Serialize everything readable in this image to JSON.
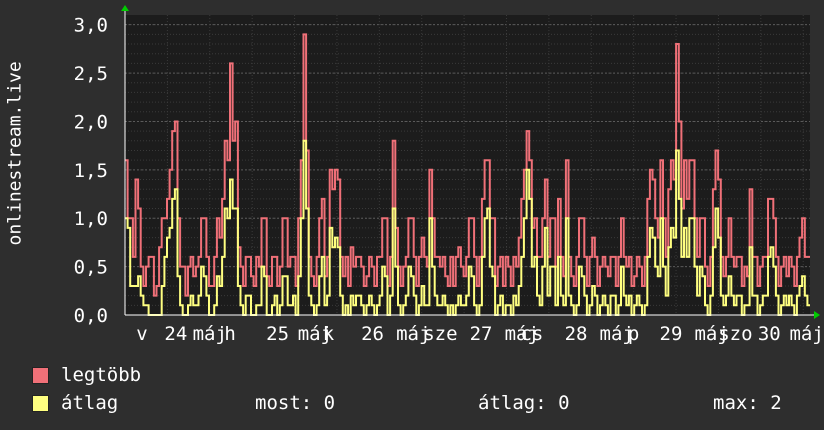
{
  "chart_data": {
    "type": "line",
    "ylabel": "onlinestream.live",
    "ylim": [
      0,
      3.1
    ],
    "y_ticks": [
      "0,0",
      "0,5",
      "1,0",
      "1,5",
      "2,0",
      "2,5",
      "3,0"
    ],
    "y_tick_values": [
      0,
      0.5,
      1.0,
      1.5,
      2.0,
      2.5,
      3.0
    ],
    "x_ticks": [
      {
        "label": "v",
        "pos": 0.05
      },
      {
        "label": "24",
        "pos": 0.15
      },
      {
        "label": "máj",
        "pos": 0.25
      },
      {
        "label": "h",
        "pos": 0.31
      },
      {
        "label": "25",
        "pos": 0.45
      },
      {
        "label": "máj",
        "pos": 0.56
      },
      {
        "label": "k",
        "pos": 0.6
      },
      {
        "label": "26",
        "pos": 0.73
      },
      {
        "label": "máj",
        "pos": 0.85
      },
      {
        "label": "sze",
        "pos": 0.93
      },
      {
        "label": "27",
        "pos": 1.05
      },
      {
        "label": "máj",
        "pos": 1.17
      },
      {
        "label": "cs",
        "pos": 1.2
      },
      {
        "label": "28",
        "pos": 1.33
      },
      {
        "label": "máj",
        "pos": 1.45
      },
      {
        "label": "p",
        "pos": 1.5
      },
      {
        "label": "29",
        "pos": 1.61
      },
      {
        "label": "máj",
        "pos": 1.73
      },
      {
        "label": "szo",
        "pos": 1.8
      },
      {
        "label": "30",
        "pos": 1.9
      },
      {
        "label": "máj",
        "pos": 2.01
      }
    ],
    "grid": true,
    "series": [
      {
        "name": "legtöbb",
        "color": "#f07078",
        "values": [
          1.6,
          1.0,
          1.0,
          0.6,
          1.4,
          1.1,
          0.5,
          0.3,
          0.5,
          0.6,
          0.6,
          0.2,
          0.3,
          0.7,
          1.0,
          1.0,
          1.2,
          1.5,
          1.9,
          2.0,
          1.0,
          0.5,
          0.5,
          0.2,
          0.5,
          0.6,
          0.4,
          0.5,
          0.6,
          1.0,
          1.0,
          0.6,
          0.3,
          0.3,
          0.6,
          1.0,
          0.8,
          1.2,
          1.8,
          1.6,
          2.6,
          1.8,
          2.0,
          0.7,
          0.5,
          0.3,
          0.6,
          0.6,
          0.4,
          0.3,
          0.6,
          0.5,
          1.0,
          1.0,
          0.4,
          0.3,
          0.6,
          0.6,
          0.3,
          0.5,
          1.0,
          1.0,
          0.5,
          0.6,
          0.6,
          0.3,
          1.0,
          1.6,
          2.9,
          1.7,
          0.6,
          0.4,
          0.3,
          0.6,
          1.0,
          1.2,
          0.4,
          0.6,
          1.5,
          1.3,
          1.5,
          1.4,
          0.6,
          0.4,
          0.6,
          0.3,
          0.7,
          0.5,
          0.6,
          0.6,
          0.5,
          0.3,
          0.4,
          0.6,
          0.5,
          0.3,
          0.6,
          0.6,
          1.0,
          1.0,
          0.3,
          0.6,
          1.8,
          0.9,
          0.5,
          0.3,
          0.5,
          0.6,
          1.0,
          1.0,
          0.6,
          0.3,
          0.6,
          0.8,
          0.6,
          0.5,
          1.5,
          1.0,
          0.6,
          0.6,
          0.5,
          0.6,
          0.4,
          0.3,
          0.6,
          0.3,
          0.6,
          0.7,
          0.5,
          0.4,
          0.6,
          1.0,
          1.0,
          0.6,
          0.3,
          0.6,
          1.2,
          1.6,
          1.6,
          1.0,
          1.0,
          0.3,
          0.5,
          0.6,
          0.3,
          0.6,
          0.5,
          0.3,
          0.6,
          0.5,
          0.8,
          1.2,
          1.5,
          1.9,
          1.6,
          0.9,
          1.0,
          0.6,
          0.6,
          1.0,
          1.4,
          0.6,
          1.0,
          1.0,
          0.5,
          1.2,
          0.6,
          0.4,
          1.6,
          0.6,
          0.4,
          0.3,
          0.6,
          1.0,
          1.0,
          0.6,
          0.3,
          0.6,
          0.8,
          0.6,
          0.3,
          0.5,
          0.6,
          0.5,
          0.4,
          0.6,
          0.6,
          0.3,
          0.6,
          1.0,
          0.6,
          0.5,
          0.6,
          0.3,
          0.4,
          0.6,
          0.5,
          0.3,
          0.6,
          1.2,
          1.5,
          1.4,
          1.0,
          0.8,
          1.6,
          1.0,
          0.6,
          1.3,
          1.6,
          1.4,
          2.8,
          2.0,
          1.1,
          1.6,
          1.2,
          1.6,
          1.6,
          1.0,
          0.6,
          1.0,
          1.0,
          0.5,
          0.3,
          0.6,
          1.3,
          1.7,
          1.4,
          0.6,
          0.4,
          0.6,
          1.0,
          0.6,
          0.5,
          0.6,
          0.6,
          0.3,
          0.5,
          0.4,
          1.3,
          0.6,
          0.6,
          0.3,
          0.5,
          0.6,
          0.6,
          1.2,
          1.2,
          1.0,
          0.6,
          0.3,
          0.5,
          0.6,
          0.4,
          0.6,
          0.5,
          0.3,
          0.6,
          0.8,
          1.0,
          0.6,
          0.6
        ]
      },
      {
        "name": "átlag",
        "color": "#ffff80",
        "values": [
          1.0,
          0.9,
          0.3,
          0.3,
          0.3,
          0.4,
          0.2,
          0.1,
          0.1,
          0.0,
          0.0,
          0.0,
          0.0,
          0.0,
          0.3,
          0.6,
          0.8,
          0.9,
          1.2,
          1.3,
          0.4,
          0.1,
          0.0,
          0.0,
          0.1,
          0.2,
          0.1,
          0.1,
          0.2,
          0.5,
          0.4,
          0.2,
          0.0,
          0.0,
          0.1,
          0.4,
          0.3,
          0.6,
          1.1,
          1.0,
          1.4,
          1.1,
          1.1,
          0.3,
          0.1,
          0.0,
          0.2,
          0.2,
          0.0,
          0.0,
          0.1,
          0.1,
          0.5,
          0.4,
          0.0,
          0.0,
          0.1,
          0.2,
          0.0,
          0.1,
          0.4,
          0.4,
          0.1,
          0.1,
          0.2,
          0.0,
          0.4,
          1.0,
          1.8,
          1.1,
          0.2,
          0.1,
          0.0,
          0.1,
          0.4,
          0.6,
          0.1,
          0.2,
          0.9,
          0.7,
          0.8,
          0.7,
          0.2,
          0.0,
          0.1,
          0.0,
          0.2,
          0.1,
          0.2,
          0.2,
          0.1,
          0.0,
          0.1,
          0.2,
          0.1,
          0.0,
          0.1,
          0.2,
          0.5,
          0.4,
          0.0,
          0.2,
          1.1,
          0.5,
          0.1,
          0.0,
          0.1,
          0.2,
          0.5,
          0.4,
          0.2,
          0.0,
          0.1,
          0.3,
          0.1,
          0.1,
          1.0,
          0.5,
          0.2,
          0.1,
          0.1,
          0.2,
          0.1,
          0.0,
          0.1,
          0.0,
          0.1,
          0.2,
          0.1,
          0.1,
          0.2,
          0.5,
          0.4,
          0.1,
          0.0,
          0.1,
          0.6,
          1.0,
          1.1,
          0.5,
          0.4,
          0.0,
          0.1,
          0.2,
          0.0,
          0.1,
          0.1,
          0.0,
          0.2,
          0.1,
          0.3,
          0.6,
          1.0,
          1.5,
          1.2,
          0.5,
          0.6,
          0.2,
          0.1,
          0.5,
          0.9,
          0.2,
          0.5,
          0.5,
          0.1,
          0.6,
          0.2,
          0.1,
          1.0,
          0.2,
          0.1,
          0.0,
          0.1,
          0.5,
          0.4,
          0.2,
          0.0,
          0.1,
          0.3,
          0.2,
          0.0,
          0.1,
          0.2,
          0.1,
          0.0,
          0.2,
          0.2,
          0.0,
          0.1,
          0.5,
          0.2,
          0.1,
          0.2,
          0.0,
          0.1,
          0.2,
          0.1,
          0.0,
          0.1,
          0.6,
          0.9,
          0.8,
          0.5,
          0.4,
          1.0,
          0.5,
          0.2,
          0.7,
          0.9,
          0.8,
          1.7,
          1.2,
          0.6,
          0.9,
          0.6,
          1.0,
          1.0,
          0.5,
          0.2,
          0.5,
          0.4,
          0.1,
          0.0,
          0.2,
          0.7,
          1.1,
          0.8,
          0.2,
          0.1,
          0.2,
          0.4,
          0.2,
          0.1,
          0.2,
          0.2,
          0.0,
          0.1,
          0.1,
          0.7,
          0.2,
          0.2,
          0.0,
          0.1,
          0.2,
          0.2,
          0.6,
          0.7,
          0.5,
          0.2,
          0.0,
          0.1,
          0.2,
          0.1,
          0.2,
          0.1,
          0.0,
          0.2,
          0.3,
          0.4,
          0.2,
          0.1
        ]
      }
    ]
  },
  "legend": [
    {
      "label": "legtöbb",
      "color": "#f07078"
    },
    {
      "label": "átlag",
      "color": "#ffff80"
    }
  ],
  "stats": {
    "now": "most: 0",
    "avg": "átlag: 0",
    "max": "max: 2"
  },
  "colors": {
    "background": "#2e2e2e",
    "plot_background": "#1c1c1c",
    "grid_major": "#5a5a5a",
    "grid_minor": "#3a3a3a",
    "axis": "#ffffff",
    "arrow": "#00cc00"
  }
}
